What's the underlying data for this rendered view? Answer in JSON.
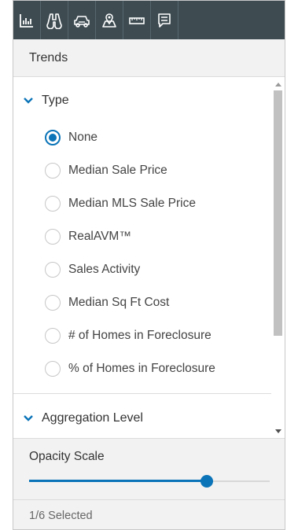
{
  "toolbar": {
    "tools": [
      {
        "icon": "chart-icon"
      },
      {
        "icon": "binoculars-icon"
      },
      {
        "icon": "car-icon"
      },
      {
        "icon": "map-pin-icon"
      },
      {
        "icon": "ruler-icon"
      },
      {
        "icon": "comment-icon"
      }
    ],
    "colors": {
      "background": "#3e4c52"
    }
  },
  "header": {
    "title": "Trends"
  },
  "type_group": {
    "label": "Type",
    "options": [
      {
        "label": "None",
        "selected": true
      },
      {
        "label": "Median Sale Price",
        "selected": false
      },
      {
        "label": "Median MLS Sale Price",
        "selected": false
      },
      {
        "label": "RealAVM™",
        "selected": false
      },
      {
        "label": "Sales Activity",
        "selected": false
      },
      {
        "label": "Median Sq Ft Cost",
        "selected": false
      },
      {
        "label": "# of Homes in Foreclosure",
        "selected": false
      },
      {
        "label": "% of Homes in Foreclosure",
        "selected": false
      }
    ]
  },
  "aggregation_group": {
    "label": "Aggregation Level"
  },
  "opacity": {
    "label": "Opacity Scale",
    "value": 0.74
  },
  "footer": {
    "status": "1/6 Selected"
  },
  "accent_color": "#0b74b8"
}
